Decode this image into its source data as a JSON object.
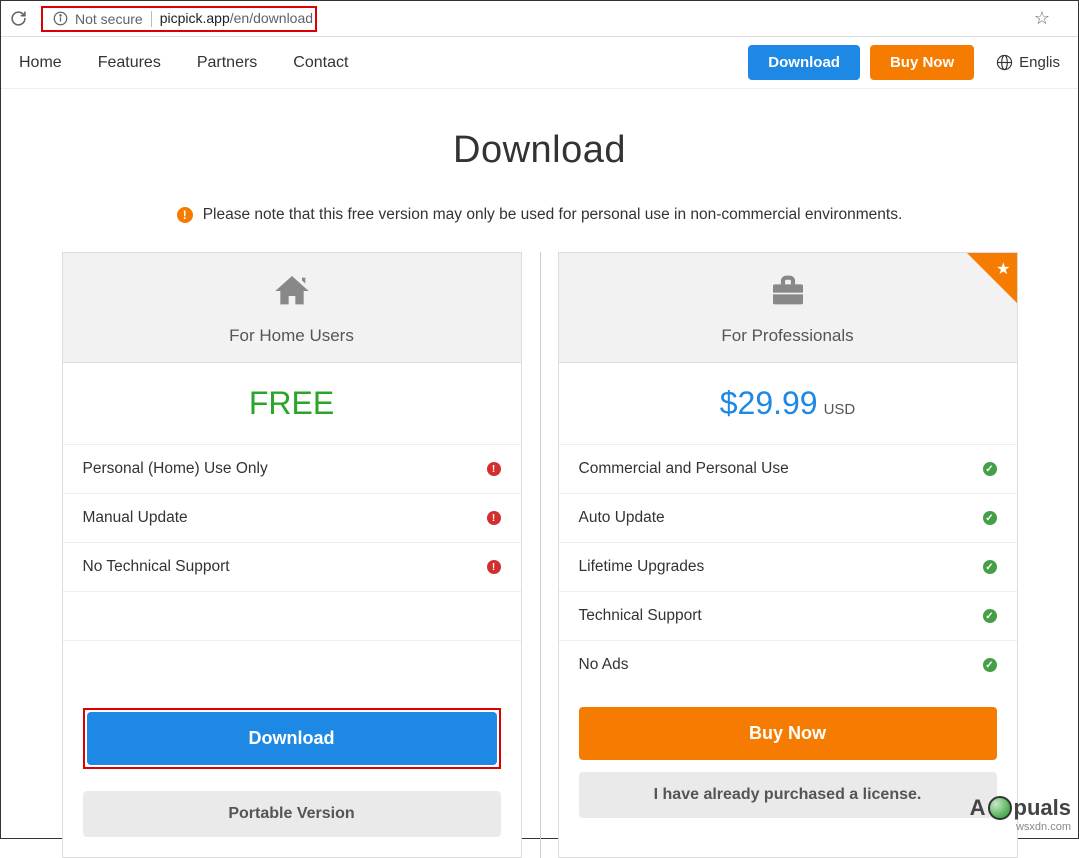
{
  "browser": {
    "not_secure": "Not secure",
    "url_host": "picpick.app",
    "url_path": "/en/download"
  },
  "nav": {
    "links": [
      "Home",
      "Features",
      "Partners",
      "Contact"
    ],
    "download": "Download",
    "buy": "Buy Now",
    "lang": "Englis"
  },
  "page": {
    "title": "Download",
    "note": "Please note that this free version may only be used for personal use in non-commercial environments."
  },
  "free": {
    "title": "For Home Users",
    "price": "FREE",
    "features": [
      "Personal (Home) Use Only",
      "Manual Update",
      "No Technical Support"
    ],
    "download_btn": "Download",
    "portable_btn": "Portable Version"
  },
  "pro": {
    "title": "For Professionals",
    "price": "$29.99",
    "currency": "USD",
    "features": [
      "Commercial and Personal Use",
      "Auto Update",
      "Lifetime Upgrades",
      "Technical Support",
      "No Ads"
    ],
    "buy_btn": "Buy Now",
    "purchased_btn": "I have already purchased a license."
  },
  "watermark": {
    "source": "wsxdn.com",
    "brand_pre": "A",
    "brand_post": "puals"
  }
}
